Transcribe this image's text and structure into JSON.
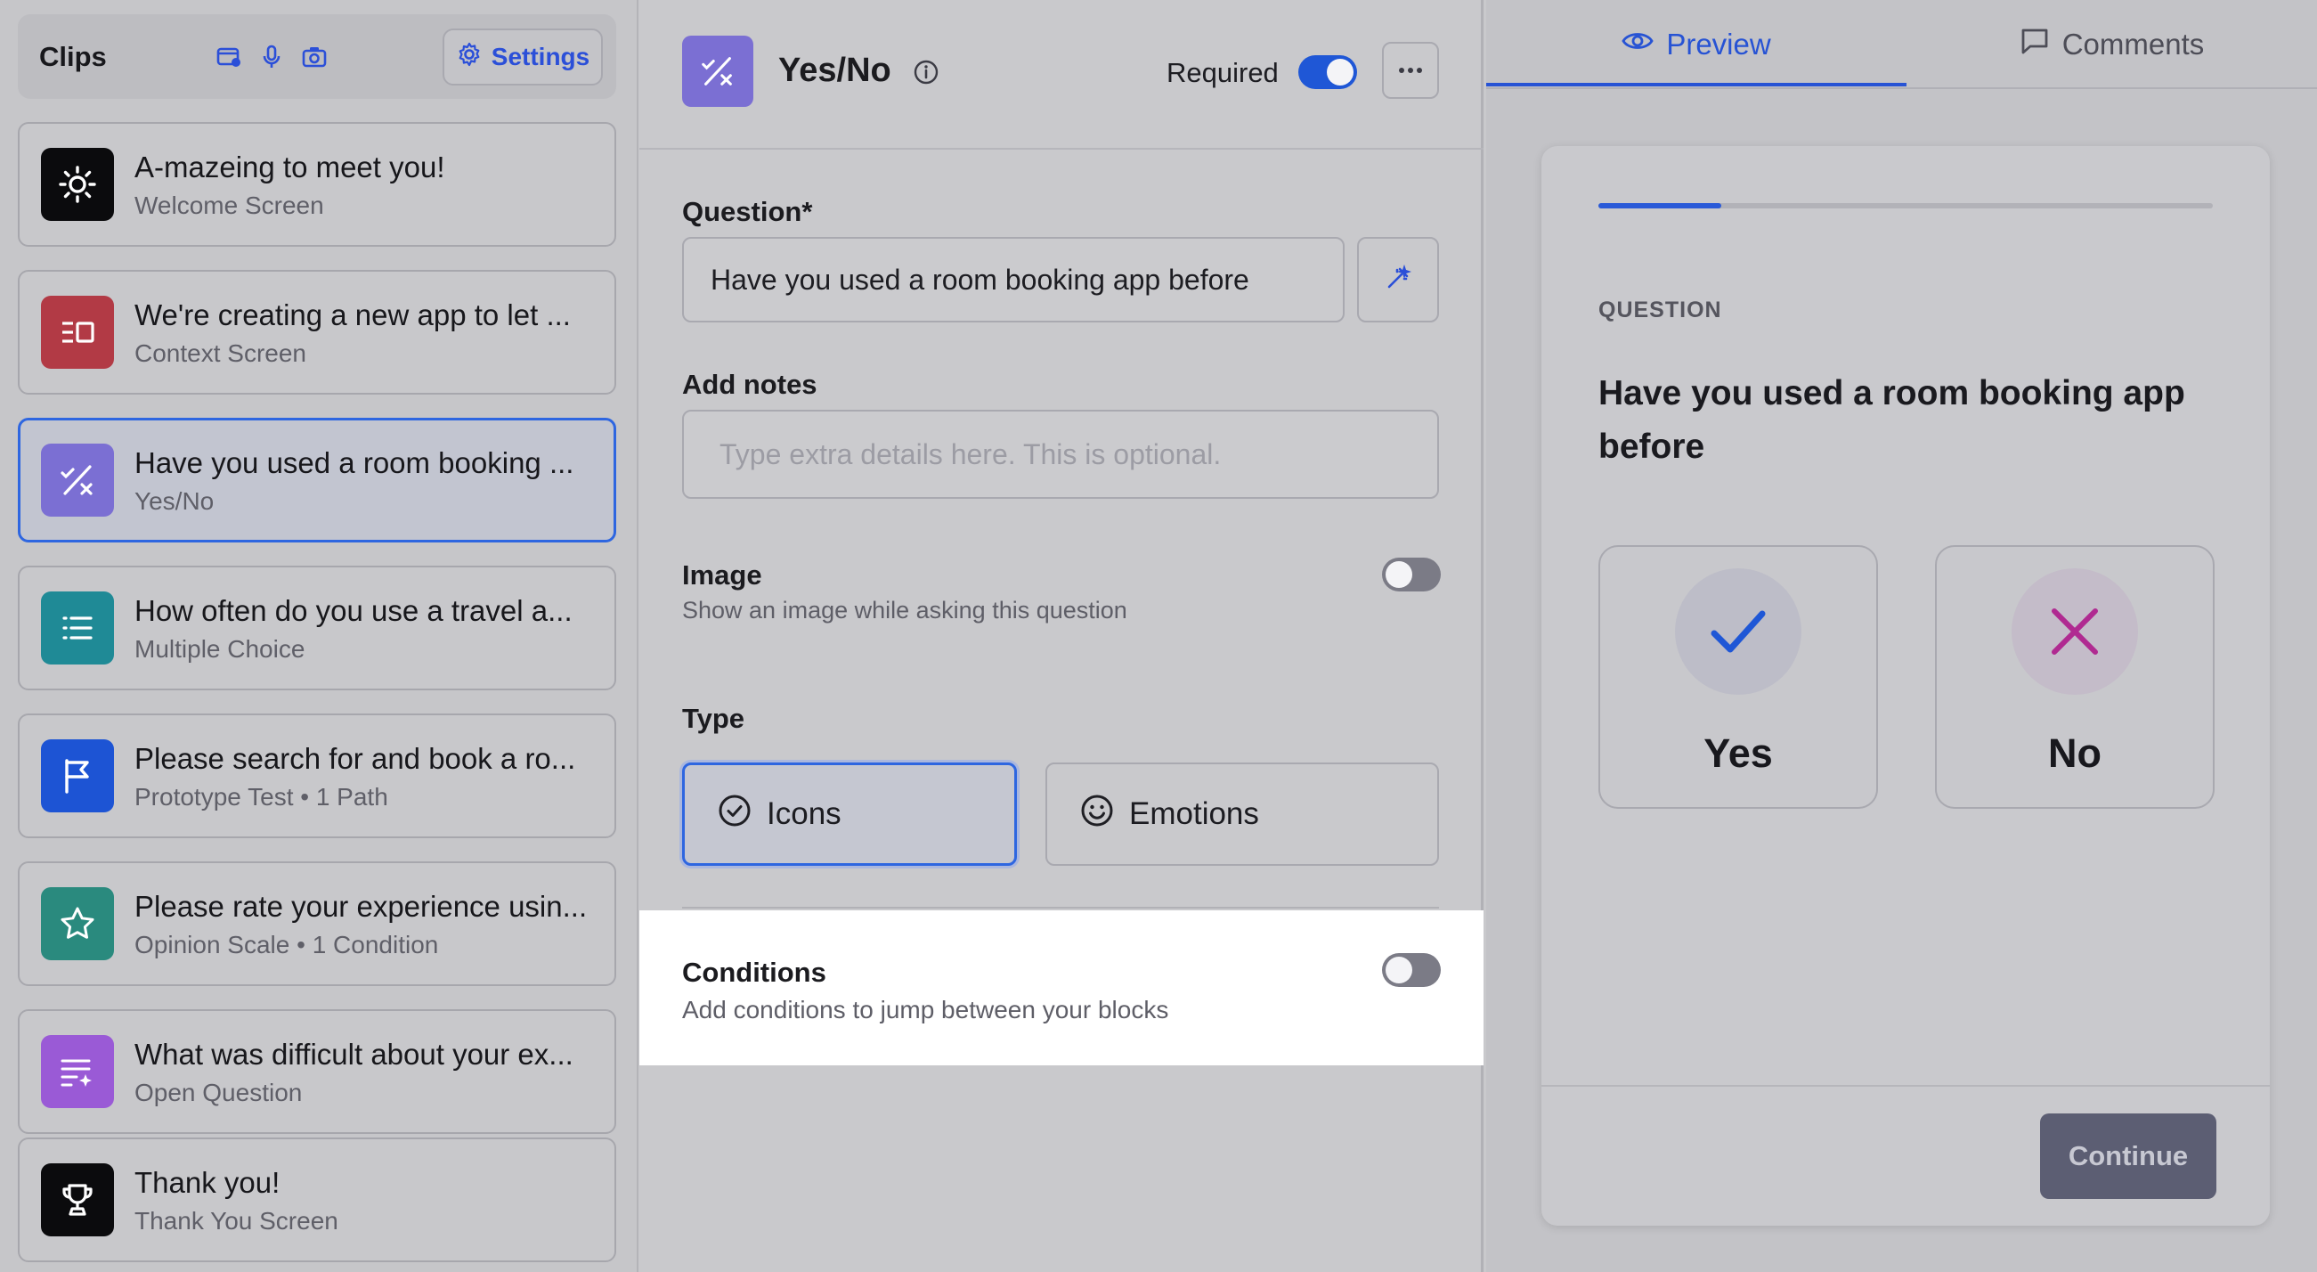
{
  "sidebar": {
    "title": "Clips",
    "header_icons": [
      "card-icon",
      "microphone-icon",
      "camera-icon"
    ],
    "settings_label": "Settings",
    "items": [
      {
        "title": "A-mazeing to meet you!",
        "subtitle": "Welcome Screen",
        "icon": "sun-icon",
        "color": "#0b0b0d"
      },
      {
        "title": "We're creating a new app to let ...",
        "subtitle": "Context Screen",
        "icon": "context-icon",
        "color": "#b23a45"
      },
      {
        "title": "Have you used a room booking ...",
        "subtitle": "Yes/No",
        "icon": "yes-no-icon",
        "color": "#7b6fd3",
        "selected": true
      },
      {
        "title": "How often do you use a travel a...",
        "subtitle": "Multiple Choice",
        "icon": "list-icon",
        "color": "#1f8a96"
      },
      {
        "title": "Please search for and book a ro...",
        "subtitle": "Prototype Test • 1 Path",
        "icon": "flag-icon",
        "color": "#1d54d4"
      },
      {
        "title": "Please rate your experience usin...",
        "subtitle": "Opinion Scale • 1 Condition",
        "icon": "star-icon",
        "color": "#2a8a7e"
      },
      {
        "title": "What was difficult about your ex...",
        "subtitle": "Open Question",
        "icon": "text-sparkle-icon",
        "color": "#9a5ad6"
      },
      {
        "title": "Thank you!",
        "subtitle": "Thank You Screen",
        "icon": "trophy-icon",
        "color": "#0b0b0d"
      }
    ]
  },
  "editor": {
    "block_title": "Yes/No",
    "required_label": "Required",
    "required_on": true,
    "question_label": "Question*",
    "question_value": "Have you used a room booking app before",
    "notes_label": "Add notes",
    "notes_placeholder": "Type extra details here. This is optional.",
    "image_label": "Image",
    "image_desc": "Show an image while asking this question",
    "image_on": false,
    "type_label": "Type",
    "type_options": [
      {
        "label": "Icons",
        "icon": "check-circle-icon",
        "selected": true
      },
      {
        "label": "Emotions",
        "icon": "smile-icon",
        "selected": false
      }
    ],
    "conditions_label": "Conditions",
    "conditions_desc": "Add conditions to jump between your blocks",
    "conditions_on": false
  },
  "preview": {
    "tabs": [
      {
        "label": "Preview",
        "icon": "eye-icon",
        "active": true
      },
      {
        "label": "Comments",
        "icon": "comment-icon",
        "active": false
      }
    ],
    "progress": 0.2,
    "caption": "QUESTION",
    "question": "Have you used a room booking app before",
    "answers": [
      {
        "label": "Yes",
        "icon": "check-icon",
        "color": "#1f57d6"
      },
      {
        "label": "No",
        "icon": "x-icon",
        "color": "#b02a91"
      }
    ],
    "continue_label": "Continue"
  },
  "colors": {
    "accent": "#2753d4",
    "toggle_on": "#1f57d6",
    "toggle_off": "#7b7b86"
  }
}
